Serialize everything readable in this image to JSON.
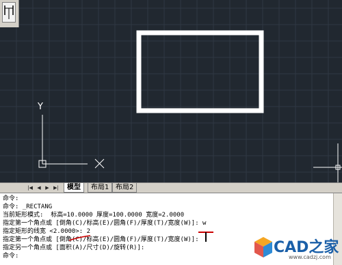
{
  "tabs": {
    "nav": [
      "|◀",
      "◀",
      "▶",
      "▶|"
    ],
    "items": [
      "模型",
      "布局1",
      "布局2"
    ],
    "active": "模型"
  },
  "command_lines": [
    "命令:",
    "命令: _RECTANG",
    "当前矩形模式:  标高=10.0000 厚度=100.0000 宽度=2.0000",
    "指定第一个角点或 [倒角(C)/标高(E)/圆角(F)/厚度(T)/宽度(W)]: w",
    "指定矩形的线宽 <2.0000>: 2",
    "指定第一个角点或 [倒角(C)/标高(E)/圆角(F)/厚度(T)/宽度(W)]:",
    "指定另一个角点或 [面积(A)/尺寸(D)/旋转(R)]:",
    "命令:"
  ],
  "ucs": {
    "y_label": "Y"
  },
  "logo": {
    "text": "CAD之家",
    "url": "www.cadzj.com"
  },
  "colors": {
    "canvas": "#212830",
    "grid": "#2f3843",
    "rectangle": "#ffffff",
    "annotation": "#cc0000"
  }
}
